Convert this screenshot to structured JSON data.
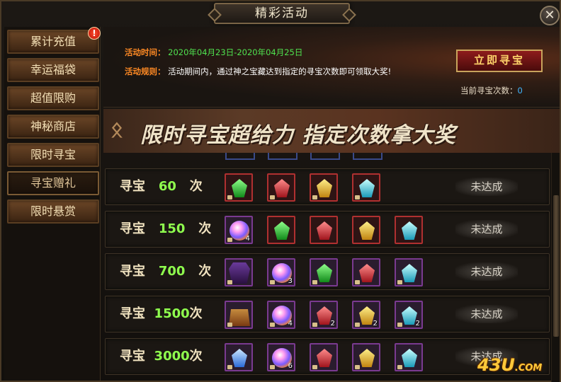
{
  "window": {
    "title": "精彩活动",
    "close_label": "✕"
  },
  "sidebar": {
    "alert_badge": "!",
    "items": [
      {
        "label": "累计充值"
      },
      {
        "label": "幸运福袋"
      },
      {
        "label": "超值限购"
      },
      {
        "label": "神秘商店"
      },
      {
        "label": "限时寻宝"
      },
      {
        "label": "寻宝赠礼",
        "active": true
      },
      {
        "label": "限时悬赏"
      }
    ]
  },
  "info": {
    "time_label": "活动时间：",
    "time_value": "2020年04月23日-2020年04月25日",
    "rule_label": "活动规则：",
    "rule_value": "活动期间内，通过神之宝藏达到指定的寻宝次数即可领取大奖!",
    "treasure_button": "立即寻宝",
    "count_label": "当前寻宝次数：",
    "count_value": "0"
  },
  "banner": {
    "deco": "ᛟ",
    "text": "限时寻宝超给力 指定次数拿大奖"
  },
  "rows": [
    {
      "pre": "寻宝",
      "num": "60",
      "post": "次",
      "status": "未达成",
      "items": [
        {
          "icon": "green-gem-icon"
        },
        {
          "icon": "red-gem-icon"
        },
        {
          "icon": "yellow-gem-icon"
        },
        {
          "icon": "cyan-gem-icon"
        }
      ]
    },
    {
      "pre": "寻宝",
      "num": "150",
      "post": "次",
      "status": "未达成",
      "items": [
        {
          "icon": "orb-icon",
          "qty": "4"
        },
        {
          "icon": "green-gem-icon"
        },
        {
          "icon": "red-gem-icon"
        },
        {
          "icon": "yellow-gem-icon"
        },
        {
          "icon": "cyan-gem-icon"
        }
      ]
    },
    {
      "pre": "寻宝",
      "num": "700",
      "post": "次",
      "status": "未达成",
      "items": [
        {
          "icon": "armor-icon"
        },
        {
          "icon": "orb-icon",
          "qty": "3"
        },
        {
          "icon": "green-gem-icon"
        },
        {
          "icon": "red-gem-icon"
        },
        {
          "icon": "cyan-gem-icon"
        }
      ]
    },
    {
      "pre": "寻宝",
      "num": "1500",
      "post": "次",
      "status": "未达成",
      "items": [
        {
          "icon": "chest-icon"
        },
        {
          "icon": "orb-icon",
          "qty": "4"
        },
        {
          "icon": "red-gem-icon",
          "qty": "2"
        },
        {
          "icon": "yellow-gem-icon",
          "qty": "2"
        },
        {
          "icon": "cyan-gem-icon",
          "qty": "2"
        }
      ]
    },
    {
      "pre": "寻宝",
      "num": "3000",
      "post": "次",
      "status": "未达成",
      "items": [
        {
          "icon": "blue-gem-icon"
        },
        {
          "icon": "orb-icon",
          "qty": "6"
        },
        {
          "icon": "red-gem-icon"
        },
        {
          "icon": "yellow-gem-icon"
        },
        {
          "icon": "cyan-gem-icon"
        }
      ]
    }
  ],
  "watermark": {
    "main": "43U",
    "suffix": ".COM"
  }
}
